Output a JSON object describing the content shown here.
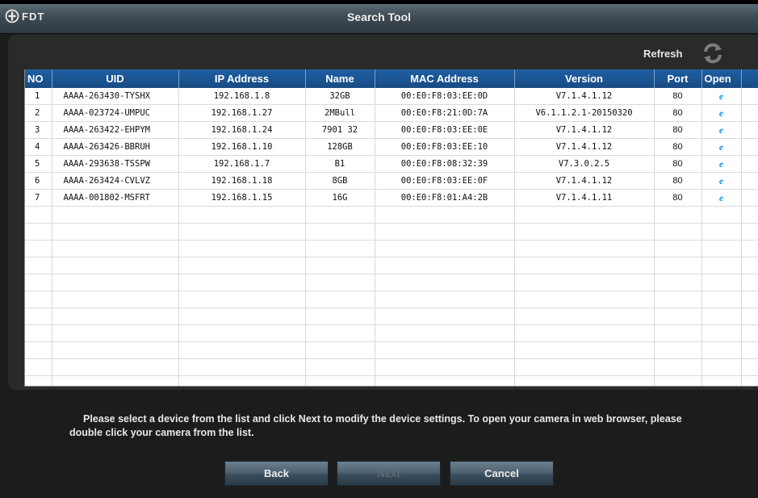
{
  "window": {
    "logo_text": "FDT",
    "title": "Search Tool"
  },
  "toolbar": {
    "refresh_label": "Refresh",
    "refresh_icon": "refresh-icon"
  },
  "table": {
    "columns": [
      "NO",
      "UID",
      "IP Address",
      "Name",
      "MAC Address",
      "Version",
      "Port",
      "Open"
    ],
    "rows": [
      {
        "no": "1",
        "uid": "AAAA-263430-TYSHX",
        "ip": "192.168.1.8",
        "name": "32GB",
        "mac": "00:E0:F8:03:EE:0D",
        "version": "V7.1.4.1.12",
        "port": "80",
        "open": "e"
      },
      {
        "no": "2",
        "uid": "AAAA-023724-UMPUC",
        "ip": "192.168.1.27",
        "name": "2MBull",
        "mac": "00:E0:F8:21:0D:7A",
        "version": "V6.1.1.2.1-20150320",
        "port": "80",
        "open": "e"
      },
      {
        "no": "3",
        "uid": "AAAA-263422-EHPYM",
        "ip": "192.168.1.24",
        "name": "7901 32",
        "mac": "00:E0:F8:03:EE:0E",
        "version": "V7.1.4.1.12",
        "port": "80",
        "open": "e"
      },
      {
        "no": "4",
        "uid": "AAAA-263426-BBRUH",
        "ip": "192.168.1.10",
        "name": "128GB",
        "mac": "00:E0:F8:03:EE:10",
        "version": "V7.1.4.1.12",
        "port": "80",
        "open": "e"
      },
      {
        "no": "5",
        "uid": "AAAA-293638-TSSPW",
        "ip": "192.168.1.7",
        "name": "B1",
        "mac": "00:E0:F8:08:32:39",
        "version": "V7.3.0.2.5",
        "port": "80",
        "open": "e"
      },
      {
        "no": "6",
        "uid": "AAAA-263424-CVLVZ",
        "ip": "192.168.1.18",
        "name": "8GB",
        "mac": "00:E0:F8:03:EE:0F",
        "version": "V7.1.4.1.12",
        "port": "80",
        "open": "e"
      },
      {
        "no": "7",
        "uid": "AAAA-001802-MSFRT",
        "ip": "192.168.1.15",
        "name": "16G",
        "mac": "00:E0:F8:01:A4:2B",
        "version": "V7.1.4.1.11",
        "port": "80",
        "open": "e"
      }
    ]
  },
  "footer": {
    "instructions": "Please select a device from the list and click Next to modify the device settings. To open your camera in web browser, please double click your camera from the list.",
    "back_label": "Back",
    "next_label": "Next",
    "cancel_label": "Cancel"
  },
  "colors": {
    "header_blue": "#1e5fa3",
    "ie_icon": "#1e8fe0"
  }
}
